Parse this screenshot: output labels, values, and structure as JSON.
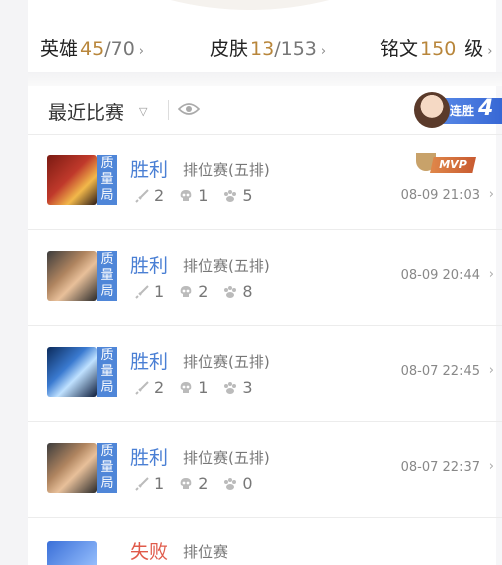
{
  "stats": {
    "heroes": {
      "label": "英雄",
      "value": "45",
      "total": "/70"
    },
    "skins": {
      "label": "皮肤",
      "value": "13",
      "total": "/153"
    },
    "runes": {
      "label": "铭文",
      "value": "150",
      "unit": "级"
    }
  },
  "section": {
    "title": "最近比赛"
  },
  "streak": {
    "text": "连胜",
    "count": "4"
  },
  "matches": [
    {
      "badge": [
        "质",
        "量",
        "局"
      ],
      "result": "胜利",
      "mode": "排位赛(五排)",
      "kills": "2",
      "deaths": "1",
      "assists": "5",
      "time": "08-09 21:03",
      "mvp": "MVP"
    },
    {
      "badge": [
        "质",
        "量",
        "局"
      ],
      "result": "胜利",
      "mode": "排位赛(五排)",
      "kills": "1",
      "deaths": "2",
      "assists": "8",
      "time": "08-09 20:44"
    },
    {
      "badge": [
        "质",
        "量",
        "局"
      ],
      "result": "胜利",
      "mode": "排位赛(五排)",
      "kills": "2",
      "deaths": "1",
      "assists": "3",
      "time": "08-07 22:45"
    },
    {
      "badge": [
        "质",
        "量",
        "局"
      ],
      "result": "胜利",
      "mode": "排位赛(五排)",
      "kills": "1",
      "deaths": "2",
      "assists": "0",
      "time": "08-07 22:37"
    }
  ],
  "partial": {
    "result": "失败",
    "mode": "排位赛"
  },
  "colors": {
    "gold": "#b8863b",
    "win": "#4a7fd4",
    "loss": "#e05a4a",
    "badge": "#4f86d8"
  }
}
